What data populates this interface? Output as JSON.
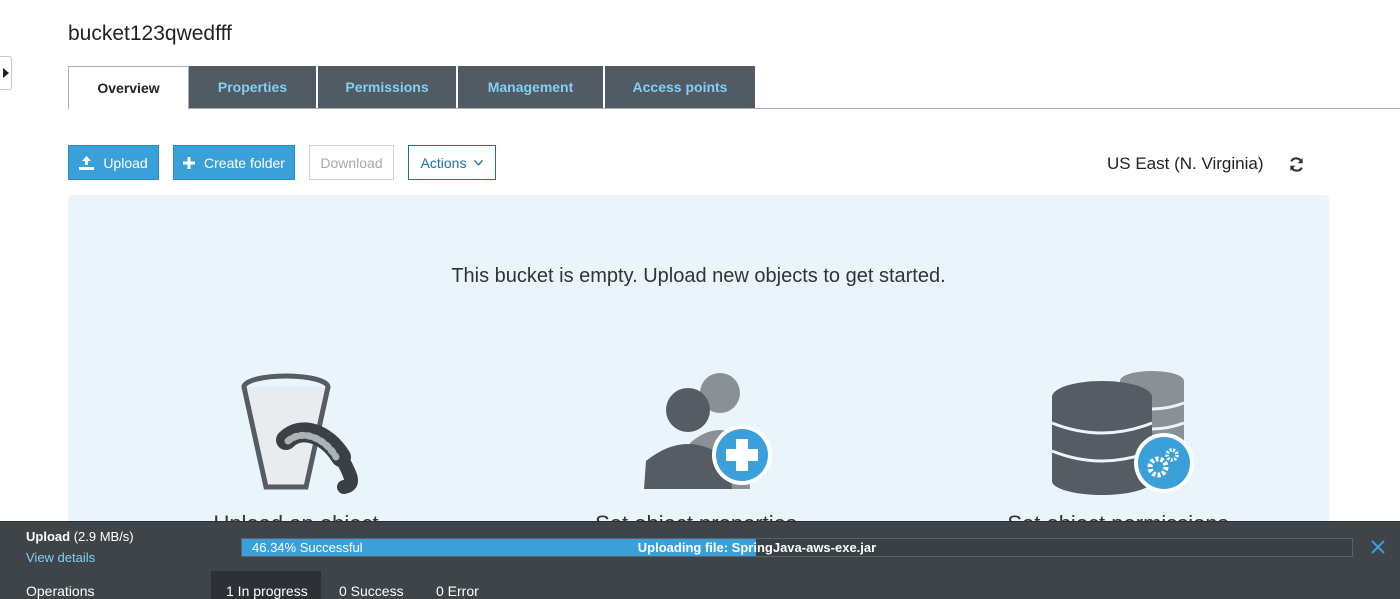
{
  "bucket": {
    "name": "bucket123qwedfff"
  },
  "tabs": [
    {
      "label": "Overview",
      "active": true
    },
    {
      "label": "Properties",
      "active": false
    },
    {
      "label": "Permissions",
      "active": false
    },
    {
      "label": "Management",
      "active": false
    },
    {
      "label": "Access points",
      "active": false
    }
  ],
  "toolbar": {
    "upload_label": "Upload",
    "create_folder_label": "Create folder",
    "download_label": "Download",
    "actions_label": "Actions",
    "region": "US East (N. Virginia)"
  },
  "empty_state": {
    "message": "This bucket is empty. Upload new objects to get started.",
    "features": [
      {
        "label": "Upload an object",
        "icon": "bucket-icon"
      },
      {
        "label": "Set object properties",
        "icon": "users-add-icon"
      },
      {
        "label": "Set object permissions",
        "icon": "database-settings-icon"
      }
    ]
  },
  "upload_status": {
    "title": "Upload",
    "speed": "(2.9 MB/s)",
    "view_details": "View details",
    "progress_fraction": 0.4634,
    "progress_text": "46.34% Successful",
    "file_text": "Uploading file: SpringJava-aws-exe.jar"
  },
  "operations": {
    "label": "Operations",
    "in_progress": "1 In progress",
    "success": "0 Success",
    "error": "0 Error"
  },
  "colors": {
    "accent": "#3aa0d9",
    "tab_bg": "#525a64",
    "tab_text": "#7fd1f5",
    "panel_bg": "#eaf5fb",
    "status_bar": "#3f4449"
  }
}
